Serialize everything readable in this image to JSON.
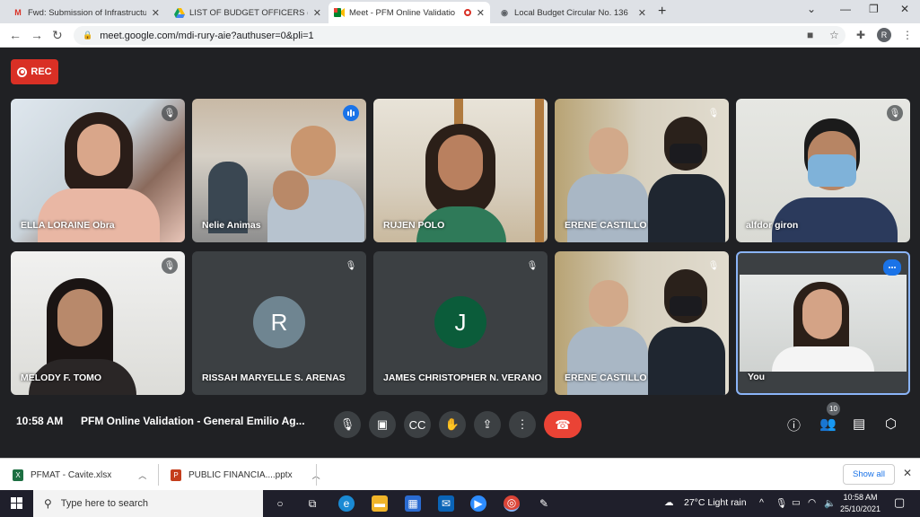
{
  "browser": {
    "tabs": [
      {
        "title": "Fwd: Submission of Infrastructure",
        "icon": "gmail-icon"
      },
      {
        "title": "LIST OF BUDGET OFFICERS (UPD",
        "icon": "drive-icon"
      },
      {
        "title": "Meet - PFM Online Validatio",
        "icon": "meet-icon"
      },
      {
        "title": "Local Budget Circular No. 136",
        "icon": "page-icon"
      }
    ],
    "url": "meet.google.com/mdi-rury-aie?authuser=0&pli=1",
    "profile_initial": "R"
  },
  "meet": {
    "rec_label": "REC",
    "participants": [
      {
        "name": "ELLA LORAINE Obra",
        "muted": true
      },
      {
        "name": "Nelie Animas",
        "muted": false,
        "speaking": true
      },
      {
        "name": "RUJEN POLO",
        "muted": false
      },
      {
        "name": "ERENE CASTILLO",
        "muted": true
      },
      {
        "name": "alfdor giron",
        "muted": true
      },
      {
        "name": "MELODY F. TOMO",
        "muted": true
      },
      {
        "name": "RISSAH MARYELLE S. ARENAS",
        "muted": true,
        "initial": "R",
        "color": "#6f8591"
      },
      {
        "name": "JAMES CHRISTOPHER N. VERANO",
        "muted": true,
        "initial": "J",
        "color": "#0b5c3a"
      },
      {
        "name": "ERENE CASTILLO",
        "muted": true
      },
      {
        "name": "You",
        "muted": false
      }
    ],
    "bottom": {
      "time": "10:58 AM",
      "meeting_title": "PFM Online Validation - General Emilio Ag...",
      "people_count": "10"
    }
  },
  "downloads": {
    "items": [
      {
        "name": "PFMAT - Cavite.xlsx",
        "type": "excel",
        "color": "#1d6f42"
      },
      {
        "name": "PUBLIC FINANCIA....pptx",
        "type": "powerpoint",
        "color": "#c43e1c"
      }
    ],
    "show_all": "Show all"
  },
  "taskbar": {
    "search_placeholder": "Type here to search",
    "weather": "27°C  Light rain",
    "time": "10:58 AM",
    "date": "25/10/2021"
  }
}
